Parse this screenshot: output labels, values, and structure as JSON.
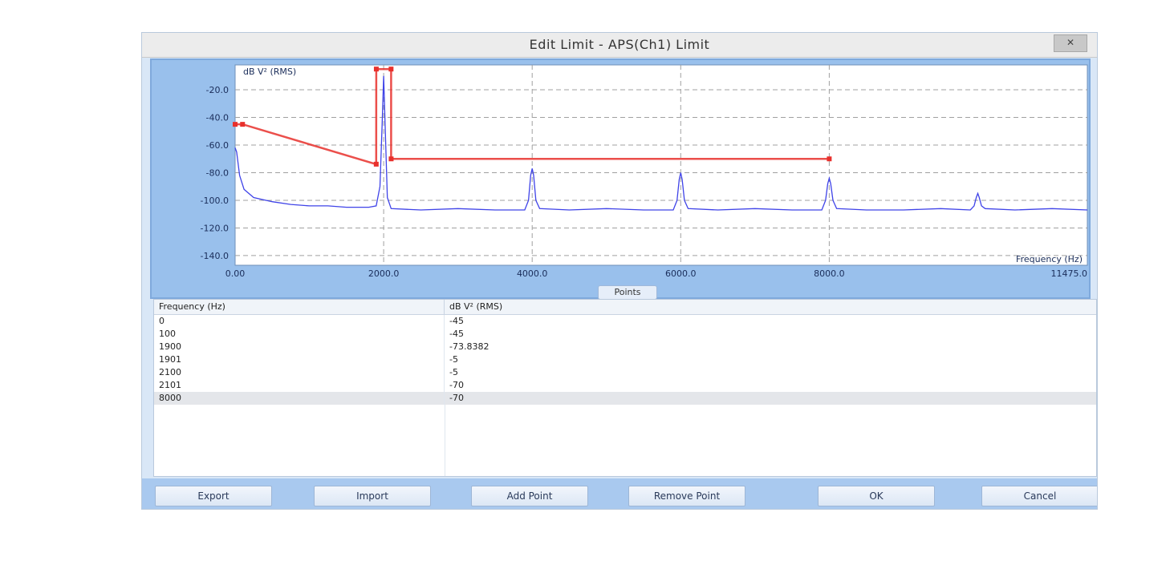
{
  "window": {
    "title": "Edit Limit - APS(Ch1) Limit",
    "close_label": "✕"
  },
  "chart_data": {
    "type": "line",
    "ylabel": "dB V² (RMS)",
    "xlabel": "Frequency (Hz)",
    "xlim": [
      0,
      11475
    ],
    "ylim": [
      -147,
      -2
    ],
    "x_ticks": [
      0,
      2000,
      4000,
      6000,
      8000,
      11475
    ],
    "x_tick_labels": [
      "0.00",
      "2000.0",
      "4000.0",
      "6000.0",
      "8000.0",
      "11475.0"
    ],
    "y_ticks": [
      -20,
      -40,
      -60,
      -80,
      -100,
      -120,
      -140
    ],
    "y_tick_labels": [
      "-20.0",
      "-40.0",
      "-60.0",
      "-80.0",
      "-100.0",
      "-120.0",
      "-140.0"
    ],
    "grid": true,
    "series": [
      {
        "kind": "spectrum",
        "color": "#3f43e8",
        "x": [
          0,
          20,
          60,
          120,
          250,
          500,
          750,
          1000,
          1250,
          1500,
          1800,
          1900,
          1950,
          1980,
          2000,
          2020,
          2050,
          2100,
          2500,
          3000,
          3500,
          3900,
          3950,
          3980,
          4000,
          4020,
          4050,
          4100,
          4500,
          5000,
          5500,
          5900,
          5950,
          5980,
          6000,
          6020,
          6050,
          6100,
          6500,
          7000,
          7500,
          7900,
          7950,
          7980,
          8000,
          8020,
          8050,
          8100,
          8500,
          9000,
          9500,
          9900,
          9950,
          9980,
          10000,
          10020,
          10050,
          10100,
          10500,
          11000,
          11475
        ],
        "y": [
          -62,
          -65,
          -82,
          -92,
          -98,
          -101,
          -103,
          -104,
          -104,
          -105,
          -105,
          -104,
          -90,
          -45,
          -10,
          -45,
          -98,
          -106,
          -107,
          -106,
          -107,
          -107,
          -100,
          -82,
          -77,
          -82,
          -100,
          -106,
          -107,
          -106,
          -107,
          -107,
          -100,
          -85,
          -80,
          -85,
          -100,
          -106,
          -107,
          -106,
          -107,
          -107,
          -100,
          -88,
          -84,
          -88,
          -100,
          -106,
          -107,
          -107,
          -106,
          -107,
          -104,
          -98,
          -95,
          -98,
          -104,
          -106,
          -107,
          -106,
          -107
        ]
      },
      {
        "kind": "limit",
        "color": "#e8302c",
        "x": [
          0,
          100,
          1900,
          1901,
          2100,
          2101,
          8000
        ],
        "y": [
          -45,
          -45,
          -73.8382,
          -5,
          -5,
          -70,
          -70
        ]
      }
    ]
  },
  "splitter": {
    "label": "Points"
  },
  "table": {
    "headers": [
      "Frequency (Hz)",
      "dB V² (RMS)"
    ],
    "rows": [
      [
        "0",
        "-45"
      ],
      [
        "100",
        "-45"
      ],
      [
        "1900",
        "-73.8382"
      ],
      [
        "1901",
        "-5"
      ],
      [
        "2100",
        "-5"
      ],
      [
        "2101",
        "-70"
      ],
      [
        "8000",
        "-70"
      ]
    ],
    "selected_index": 6
  },
  "buttons": {
    "export": "Export",
    "import": "Import",
    "add_point": "Add Point",
    "remove_point": "Remove Point",
    "ok": "OK",
    "cancel": "Cancel"
  }
}
